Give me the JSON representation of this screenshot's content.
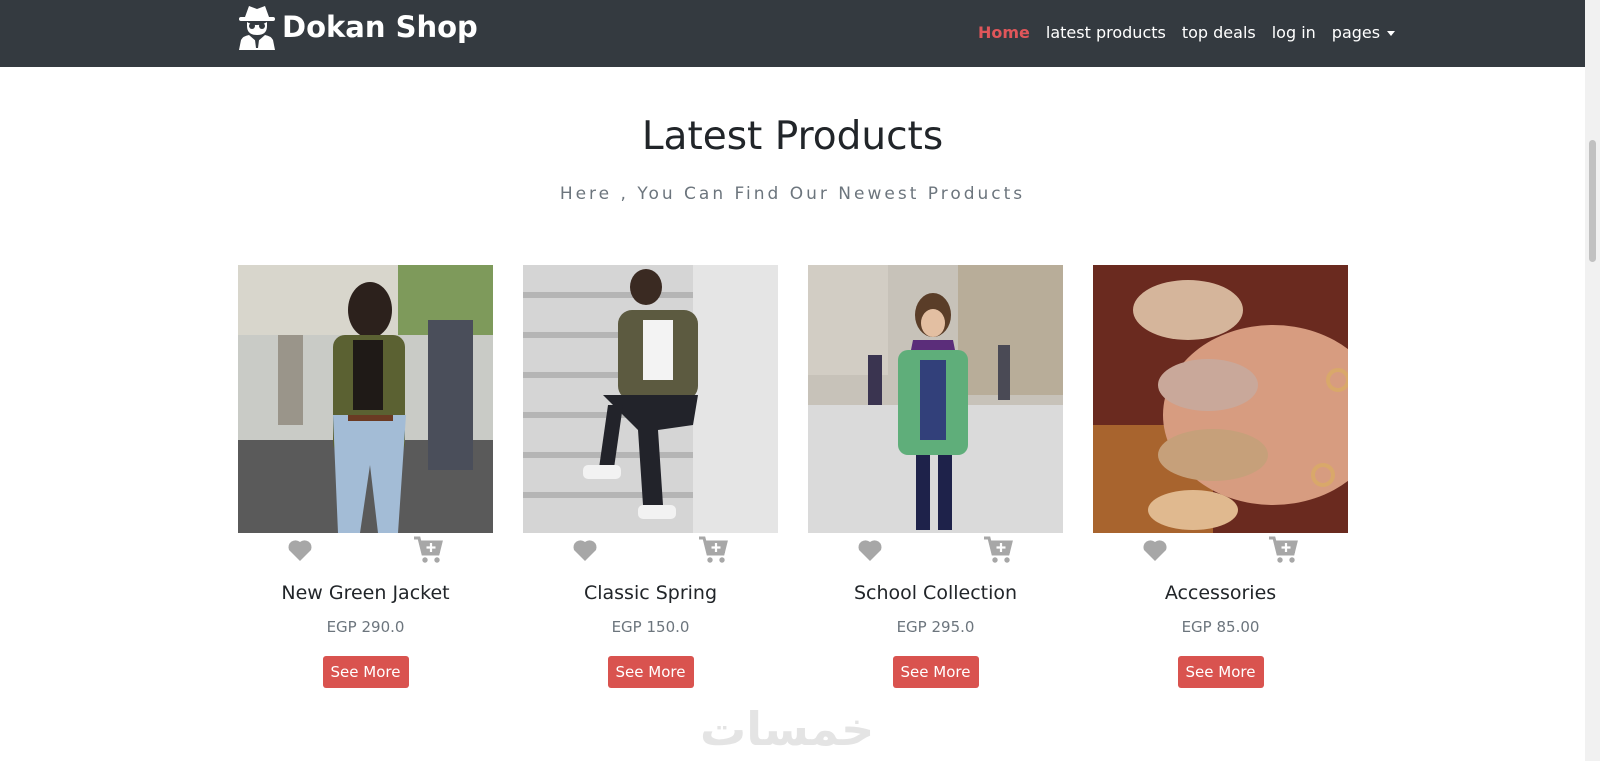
{
  "navbar": {
    "brand": "Dokan Shop",
    "links": [
      {
        "label": "Home",
        "active": true
      },
      {
        "label": "latest products"
      },
      {
        "label": "top deals"
      },
      {
        "label": "log in"
      },
      {
        "label": "pages"
      }
    ]
  },
  "section": {
    "title": "Latest Products",
    "subtitle": "Here , You Can Find Our Newest Products"
  },
  "products": [
    {
      "name": "New Green Jacket",
      "price": "EGP 290.0",
      "button": "See More"
    },
    {
      "name": "Classic Spring",
      "price": "EGP 150.0",
      "button": "See More"
    },
    {
      "name": "School Collection",
      "price": "EGP 295.0",
      "button": "See More"
    },
    {
      "name": "Accessories",
      "price": "EGP 85.00",
      "button": "See More"
    }
  ],
  "watermark": "خمسات",
  "colors": {
    "navbar_bg": "#343a40",
    "active_link": "#e0565a",
    "button_bg": "#d9534f",
    "icon_gray": "#a7a7a7"
  },
  "icons": [
    "spy-icon",
    "heart-icon",
    "cart-plus-icon",
    "caret-down-icon"
  ]
}
